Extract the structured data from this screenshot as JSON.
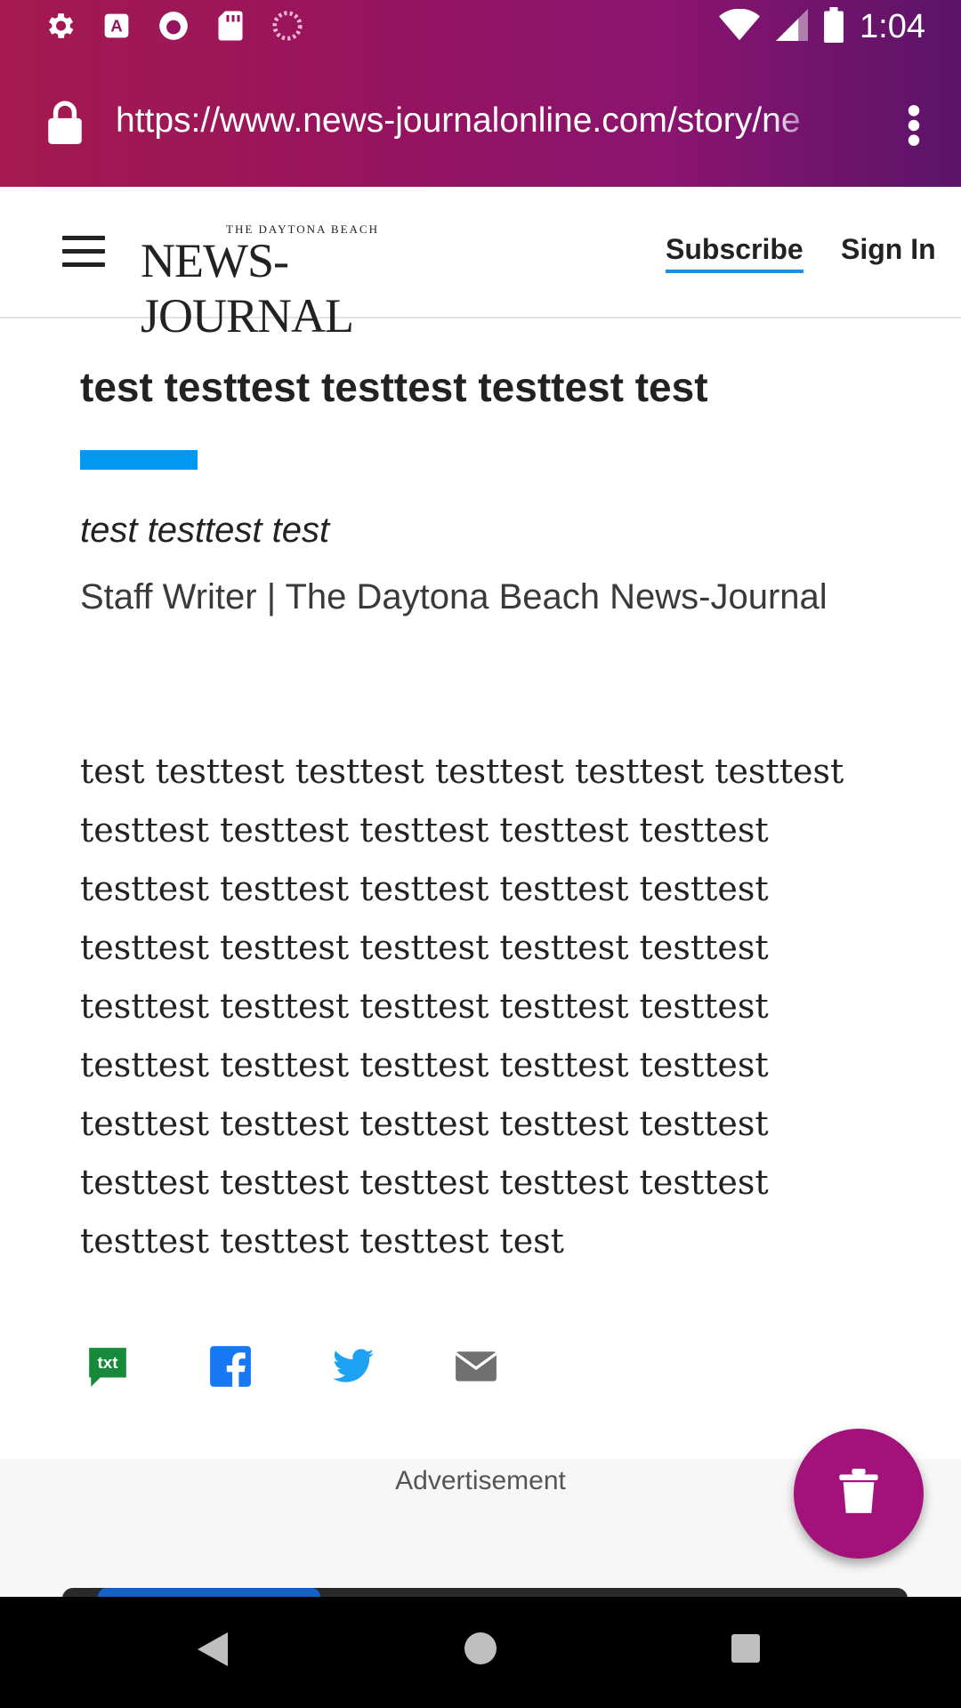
{
  "status_bar": {
    "time": "1:04",
    "icons": [
      "settings-icon",
      "font-app-icon",
      "firefox-icon",
      "sd-card-icon",
      "loading-icon",
      "wifi-icon",
      "signal-icon",
      "battery-icon"
    ]
  },
  "browser": {
    "url": "https://www.news-journalonline.com/story/ne",
    "accent_color": "#96135f"
  },
  "site_header": {
    "logo_small": "THE DAYTONA BEACH",
    "logo_big": "NEWS-JOURNAL",
    "subscribe_label": "Subscribe",
    "signin_label": "Sign In"
  },
  "article": {
    "headline": "test testtest testtest testtest test",
    "deck": "test testtest test",
    "byline": "Staff Writer  |  The Daytona Beach News-Journal",
    "body": "test testtest testtest testtest testtest testtest testtest testtest testtest testtest testtest testtest testtest testtest testtest testtest testtest testtest testtest testtest testtest testtest testtest testtest testtest testtest testtest testtest testtest testtest testtest testtest testtest testtest testtest testtest testtest testtest testtest testtest testtest testtest testtest testtest test"
  },
  "share": {
    "icons": [
      "txt-share-icon",
      "facebook-icon",
      "twitter-icon",
      "email-icon"
    ],
    "txt_label": "txt"
  },
  "ad": {
    "label": "Advertisement"
  },
  "colors": {
    "accent_blue": "#0098f0",
    "fab": "#a3127a"
  }
}
